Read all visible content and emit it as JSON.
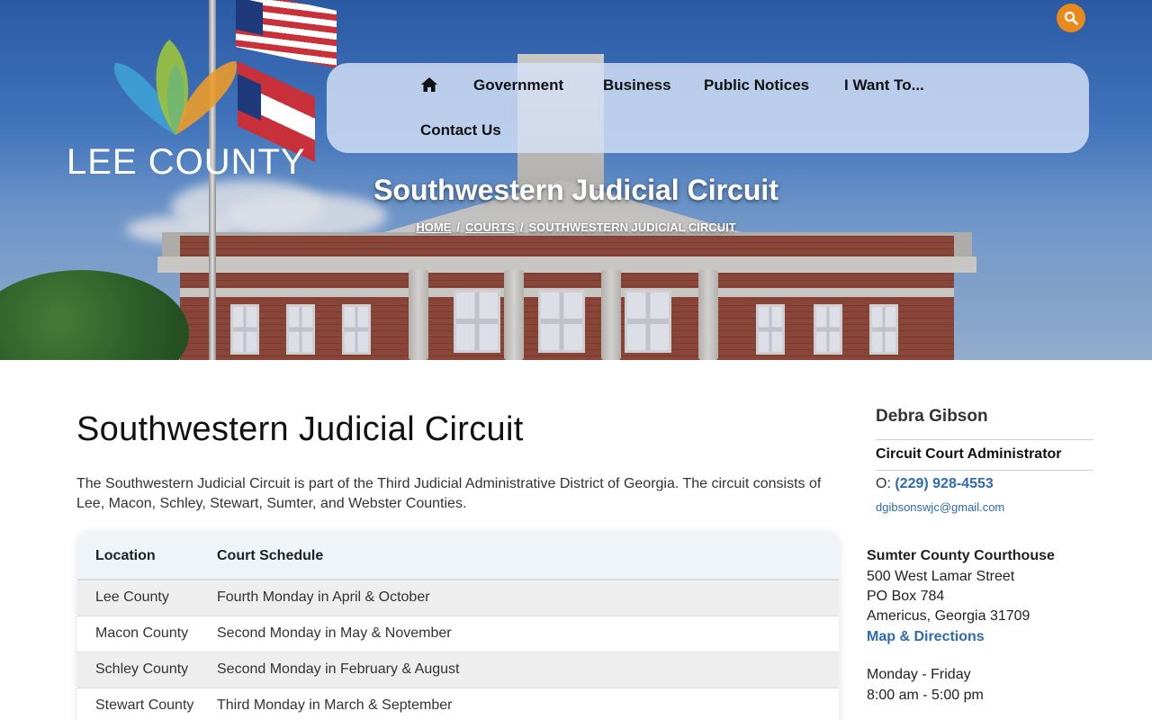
{
  "site": {
    "logo_text": "LEE COUNTY",
    "accent_color": "#e8891e",
    "link_color": "#2f6ab3"
  },
  "search": {
    "icon": "search-icon"
  },
  "nav": {
    "home_icon": "home-icon",
    "items": [
      "Government",
      "Business",
      "Public Notices",
      "I Want To...",
      "Contact Us"
    ]
  },
  "hero": {
    "title": "Southwestern Judicial Circuit",
    "breadcrumb": {
      "home": "HOME",
      "sep": "/",
      "courts": "COURTS",
      "current": "SOUTHWESTERN JUDICIAL CIRCUIT"
    }
  },
  "main": {
    "title": "Southwestern Judicial Circuit",
    "intro": "The Southwestern Judicial Circuit is part of the Third Judicial Administrative District of Georgia. The circuit consists of Lee, Macon, Schley, Stewart, Sumter, and Webster Counties.",
    "table": {
      "headers": [
        "Location",
        "Court Schedule"
      ],
      "rows": [
        [
          "Lee County",
          "Fourth Monday in April & October"
        ],
        [
          "Macon County",
          "Second Monday in May & November"
        ],
        [
          "Schley County",
          "Second Monday in February & August"
        ],
        [
          "Stewart County",
          "Third Monday in March & September"
        ]
      ]
    }
  },
  "sidebar": {
    "contact_name": "Debra Gibson",
    "contact_role": "Circuit Court Administrator",
    "phone_prefix": "O:",
    "phone": "(229) 928-4553",
    "email": "dgibsonswjc@gmail.com",
    "address": {
      "name": "Sumter County Courthouse",
      "street": "500 West Lamar Street",
      "po_box": "PO Box 784",
      "city": "Americus, Georgia 31709",
      "map_link": "Map & Directions"
    },
    "hours": {
      "days": "Monday - Friday",
      "time": "8:00 am - 5:00 pm"
    }
  }
}
